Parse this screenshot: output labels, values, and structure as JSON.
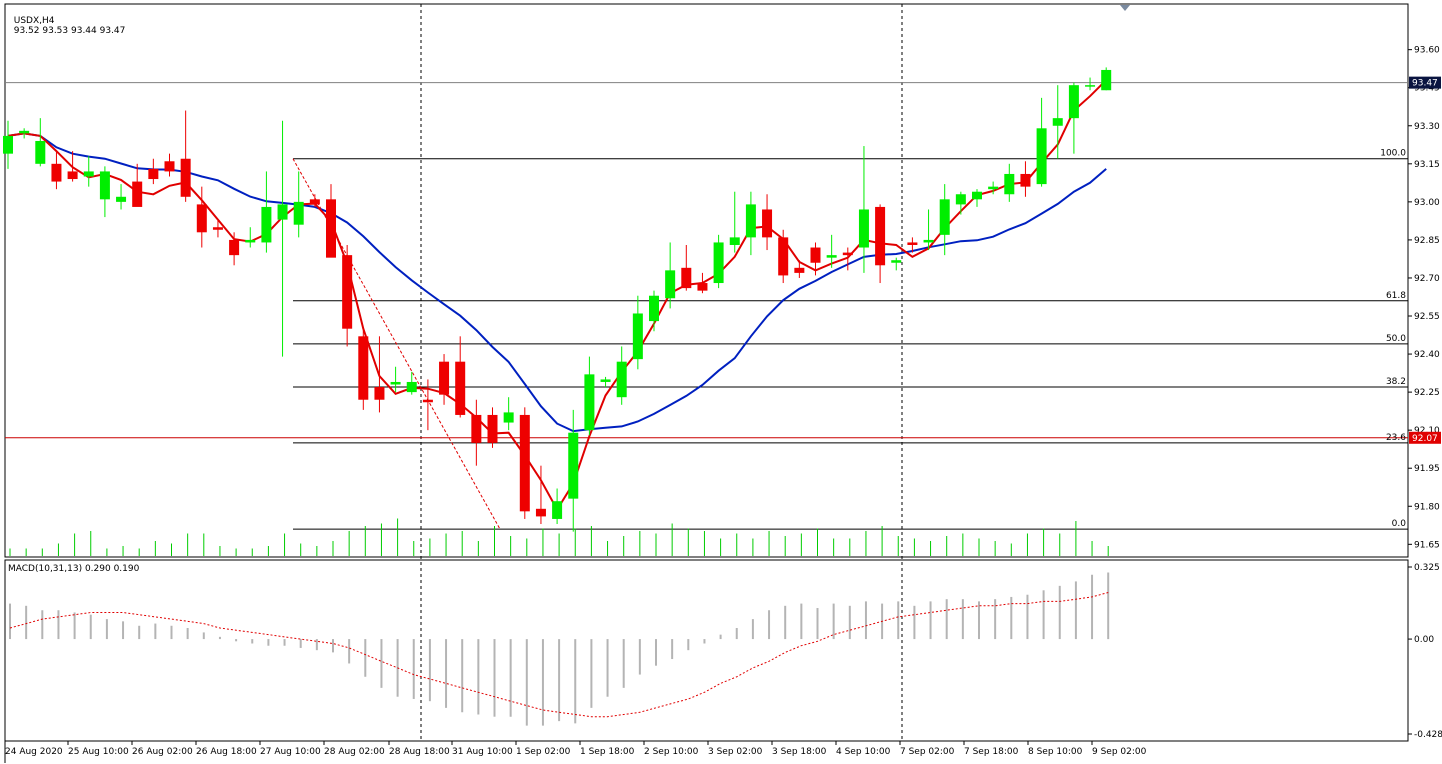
{
  "chart_data": {
    "type": "candlestick",
    "header": {
      "symbol": "USDX,H4",
      "ohlc": "93.52 93.53 93.44 93.47"
    },
    "indicator_label": "MACD(10,31,13) 0.290 0.190",
    "price_axis": {
      "ylim": [
        91.6,
        93.78
      ],
      "ticks": [
        "93.60",
        "93.45",
        "93.30",
        "93.15",
        "93.00",
        "92.85",
        "92.70",
        "92.55",
        "92.40",
        "92.25",
        "92.10",
        "91.95",
        "91.80",
        "91.65"
      ],
      "tick_values": [
        93.6,
        93.45,
        93.3,
        93.15,
        93.0,
        92.85,
        92.7,
        92.55,
        92.4,
        92.25,
        92.1,
        91.95,
        91.8,
        91.65
      ]
    },
    "macd_axis": {
      "ylim": [
        -0.428,
        0.325
      ],
      "ticks": [
        "0.325",
        "0.00",
        "-0.428"
      ],
      "tick_values": [
        0.325,
        0.0,
        -0.428
      ]
    },
    "current_price": {
      "label": "93.47",
      "value": 93.47
    },
    "level_line": {
      "label": "92.07",
      "value": 92.07
    },
    "fib_levels": [
      {
        "label": "100.0",
        "value": 93.17
      },
      {
        "label": "61.8",
        "value": 92.61
      },
      {
        "label": "50.0",
        "value": 92.44
      },
      {
        "label": "38.2",
        "value": 92.27
      },
      {
        "label": "23.6",
        "value": 92.05
      },
      {
        "label": "0.0",
        "value": 91.71
      }
    ],
    "x_labels": [
      "24 Aug 2020",
      "25 Aug 10:00",
      "26 Aug 02:00",
      "26 Aug 18:00",
      "27 Aug 10:00",
      "28 Aug 02:00",
      "28 Aug 18:00",
      "31 Aug 10:00",
      "1 Sep 02:00",
      "1 Sep 18:00",
      "2 Sep 10:00",
      "3 Sep 02:00",
      "3 Sep 18:00",
      "4 Sep 10:00",
      "7 Sep 02:00",
      "7 Sep 18:00",
      "8 Sep 10:00",
      "9 Sep 02:00"
    ],
    "candles": [
      {
        "o": 93.19,
        "h": 93.32,
        "l": 93.13,
        "c": 93.26
      },
      {
        "o": 93.27,
        "h": 93.29,
        "l": 93.25,
        "c": 93.28
      },
      {
        "o": 93.15,
        "h": 93.33,
        "l": 93.14,
        "c": 93.24
      },
      {
        "o": 93.15,
        "h": 93.2,
        "l": 93.05,
        "c": 93.08
      },
      {
        "o": 93.12,
        "h": 93.2,
        "l": 93.08,
        "c": 93.09
      },
      {
        "o": 93.1,
        "h": 93.18,
        "l": 93.06,
        "c": 93.12
      },
      {
        "o": 93.01,
        "h": 93.14,
        "l": 92.94,
        "c": 93.12
      },
      {
        "o": 93.0,
        "h": 93.07,
        "l": 92.97,
        "c": 93.02
      },
      {
        "o": 93.08,
        "h": 93.15,
        "l": 93.0,
        "c": 92.98
      },
      {
        "o": 93.13,
        "h": 93.17,
        "l": 93.07,
        "c": 93.09
      },
      {
        "o": 93.16,
        "h": 93.19,
        "l": 93.1,
        "c": 93.12
      },
      {
        "o": 93.17,
        "h": 93.36,
        "l": 93.0,
        "c": 93.02
      },
      {
        "o": 92.99,
        "h": 93.06,
        "l": 92.82,
        "c": 92.88
      },
      {
        "o": 92.9,
        "h": 92.93,
        "l": 92.86,
        "c": 92.89
      },
      {
        "o": 92.85,
        "h": 92.88,
        "l": 92.75,
        "c": 92.79
      },
      {
        "o": 92.84,
        "h": 92.9,
        "l": 92.82,
        "c": 92.85
      },
      {
        "o": 92.84,
        "h": 93.12,
        "l": 92.8,
        "c": 92.98
      },
      {
        "o": 92.93,
        "h": 93.32,
        "l": 92.39,
        "c": 92.99
      },
      {
        "o": 92.91,
        "h": 93.12,
        "l": 92.86,
        "c": 93.0
      },
      {
        "o": 93.01,
        "h": 93.03,
        "l": 92.98,
        "c": 92.99
      },
      {
        "o": 93.01,
        "h": 93.07,
        "l": 92.9,
        "c": 92.78
      },
      {
        "o": 92.79,
        "h": 92.83,
        "l": 92.43,
        "c": 92.5
      },
      {
        "o": 92.47,
        "h": 92.5,
        "l": 92.18,
        "c": 92.22
      },
      {
        "o": 92.27,
        "h": 92.47,
        "l": 92.17,
        "c": 92.22
      },
      {
        "o": 92.28,
        "h": 92.35,
        "l": 92.25,
        "c": 92.29
      },
      {
        "o": 92.25,
        "h": 92.33,
        "l": 92.24,
        "c": 92.29
      },
      {
        "o": 92.22,
        "h": 92.3,
        "l": 92.1,
        "c": 92.21
      },
      {
        "o": 92.37,
        "h": 92.4,
        "l": 92.2,
        "c": 92.24
      },
      {
        "o": 92.37,
        "h": 92.47,
        "l": 92.15,
        "c": 92.16
      },
      {
        "o": 92.16,
        "h": 92.22,
        "l": 91.96,
        "c": 92.05
      },
      {
        "o": 92.16,
        "h": 92.19,
        "l": 92.03,
        "c": 92.05
      },
      {
        "o": 92.13,
        "h": 92.23,
        "l": 92.1,
        "c": 92.17
      },
      {
        "o": 92.16,
        "h": 92.19,
        "l": 91.75,
        "c": 91.78
      },
      {
        "o": 91.79,
        "h": 91.96,
        "l": 91.73,
        "c": 91.76
      },
      {
        "o": 91.75,
        "h": 91.87,
        "l": 91.73,
        "c": 91.82
      },
      {
        "o": 91.83,
        "h": 92.18,
        "l": 91.7,
        "c": 92.09
      },
      {
        "o": 92.1,
        "h": 92.39,
        "l": 92.08,
        "c": 92.32
      },
      {
        "o": 92.29,
        "h": 92.31,
        "l": 92.27,
        "c": 92.3
      },
      {
        "o": 92.23,
        "h": 92.43,
        "l": 92.2,
        "c": 92.37
      },
      {
        "o": 92.38,
        "h": 92.63,
        "l": 92.34,
        "c": 92.56
      },
      {
        "o": 92.53,
        "h": 92.65,
        "l": 92.49,
        "c": 92.63
      },
      {
        "o": 92.62,
        "h": 92.84,
        "l": 92.58,
        "c": 92.73
      },
      {
        "o": 92.74,
        "h": 92.83,
        "l": 92.65,
        "c": 92.66
      },
      {
        "o": 92.68,
        "h": 92.72,
        "l": 92.64,
        "c": 92.65
      },
      {
        "o": 92.68,
        "h": 92.87,
        "l": 92.66,
        "c": 92.84
      },
      {
        "o": 92.83,
        "h": 93.04,
        "l": 92.8,
        "c": 92.86
      },
      {
        "o": 92.86,
        "h": 93.04,
        "l": 92.79,
        "c": 92.99
      },
      {
        "o": 92.97,
        "h": 93.03,
        "l": 92.81,
        "c": 92.86
      },
      {
        "o": 92.86,
        "h": 92.89,
        "l": 92.68,
        "c": 92.71
      },
      {
        "o": 92.74,
        "h": 92.77,
        "l": 92.7,
        "c": 92.72
      },
      {
        "o": 92.82,
        "h": 92.84,
        "l": 92.71,
        "c": 92.76
      },
      {
        "o": 92.78,
        "h": 92.87,
        "l": 92.74,
        "c": 92.79
      },
      {
        "o": 92.8,
        "h": 92.82,
        "l": 92.73,
        "c": 92.79
      },
      {
        "o": 92.82,
        "h": 93.22,
        "l": 92.72,
        "c": 92.97
      },
      {
        "o": 92.98,
        "h": 92.99,
        "l": 92.68,
        "c": 92.75
      },
      {
        "o": 92.76,
        "h": 92.78,
        "l": 92.73,
        "c": 92.77
      },
      {
        "o": 92.84,
        "h": 92.86,
        "l": 92.8,
        "c": 92.83
      },
      {
        "o": 92.84,
        "h": 92.97,
        "l": 92.81,
        "c": 92.85
      },
      {
        "o": 92.87,
        "h": 93.07,
        "l": 92.79,
        "c": 93.01
      },
      {
        "o": 92.99,
        "h": 93.04,
        "l": 92.95,
        "c": 93.03
      },
      {
        "o": 93.01,
        "h": 93.05,
        "l": 92.98,
        "c": 93.04
      },
      {
        "o": 93.05,
        "h": 93.08,
        "l": 93.03,
        "c": 93.06
      },
      {
        "o": 93.03,
        "h": 93.15,
        "l": 93.0,
        "c": 93.11
      },
      {
        "o": 93.11,
        "h": 93.16,
        "l": 93.02,
        "c": 93.06
      },
      {
        "o": 93.07,
        "h": 93.41,
        "l": 93.06,
        "c": 93.29
      },
      {
        "o": 93.3,
        "h": 93.46,
        "l": 93.17,
        "c": 93.33
      },
      {
        "o": 93.33,
        "h": 93.47,
        "l": 93.19,
        "c": 93.46
      },
      {
        "o": 93.46,
        "h": 93.49,
        "l": 93.44,
        "c": 93.46
      },
      {
        "o": 93.44,
        "h": 93.53,
        "l": 93.44,
        "c": 93.52
      }
    ],
    "volume": [
      3,
      3,
      3,
      5,
      9,
      10,
      3,
      4,
      3,
      6,
      5,
      9,
      9,
      4,
      3,
      3,
      4,
      9,
      5,
      4,
      6,
      10,
      12,
      13,
      15,
      6,
      7,
      9,
      10,
      6,
      12,
      8,
      7,
      11,
      9,
      11,
      12,
      6,
      8,
      10,
      9,
      13,
      11,
      10,
      7,
      9,
      7,
      10,
      8,
      9,
      11,
      7,
      7,
      10,
      12,
      8,
      7,
      6,
      8,
      9,
      7,
      6,
      5,
      9,
      11,
      9,
      14,
      6,
      4
    ],
    "macd_hist": [
      0.16,
      0.15,
      0.13,
      0.13,
      0.12,
      0.11,
      0.09,
      0.08,
      0.06,
      0.07,
      0.06,
      0.05,
      0.03,
      0.01,
      -0.01,
      -0.02,
      -0.03,
      -0.03,
      -0.04,
      -0.05,
      -0.06,
      -0.11,
      -0.17,
      -0.22,
      -0.26,
      -0.27,
      -0.28,
      -0.31,
      -0.33,
      -0.34,
      -0.35,
      -0.35,
      -0.39,
      -0.39,
      -0.37,
      -0.38,
      -0.31,
      -0.26,
      -0.22,
      -0.16,
      -0.12,
      -0.09,
      -0.05,
      -0.02,
      0.02,
      0.05,
      0.09,
      0.13,
      0.15,
      0.16,
      0.14,
      0.16,
      0.15,
      0.17,
      0.16,
      0.17,
      0.15,
      0.17,
      0.18,
      0.18,
      0.17,
      0.18,
      0.19,
      0.2,
      0.22,
      0.24,
      0.26,
      0.29,
      0.3
    ],
    "macd_signal": [
      0.05,
      0.07,
      0.09,
      0.1,
      0.11,
      0.12,
      0.12,
      0.12,
      0.11,
      0.1,
      0.09,
      0.08,
      0.07,
      0.05,
      0.04,
      0.03,
      0.02,
      0.01,
      0.0,
      -0.01,
      -0.02,
      -0.04,
      -0.07,
      -0.1,
      -0.13,
      -0.16,
      -0.18,
      -0.2,
      -0.22,
      -0.24,
      -0.26,
      -0.28,
      -0.3,
      -0.32,
      -0.33,
      -0.34,
      -0.35,
      -0.35,
      -0.34,
      -0.33,
      -0.31,
      -0.29,
      -0.27,
      -0.24,
      -0.2,
      -0.17,
      -0.13,
      -0.1,
      -0.06,
      -0.03,
      -0.01,
      0.02,
      0.04,
      0.06,
      0.08,
      0.1,
      0.11,
      0.12,
      0.13,
      0.14,
      0.15,
      0.15,
      0.16,
      0.16,
      0.17,
      0.17,
      0.18,
      0.19,
      0.21
    ]
  }
}
